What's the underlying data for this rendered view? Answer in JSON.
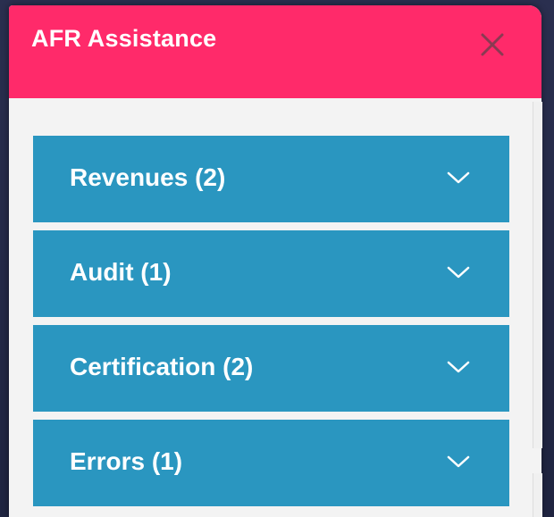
{
  "panel": {
    "title": "AFR Assistance",
    "close_icon": "close-icon"
  },
  "accordion": {
    "items": [
      {
        "label": "Revenues (2)",
        "icon": "chevron-down-icon"
      },
      {
        "label": "Audit (1)",
        "icon": "chevron-down-icon"
      },
      {
        "label": "Certification (2)",
        "icon": "chevron-down-icon"
      },
      {
        "label": "Errors (1)",
        "icon": "chevron-down-icon"
      }
    ]
  },
  "colors": {
    "header": "#ff2a6a",
    "accordion": "#2a96c0",
    "panel_bg": "#f3f3f3",
    "backdrop": "#252a45"
  }
}
